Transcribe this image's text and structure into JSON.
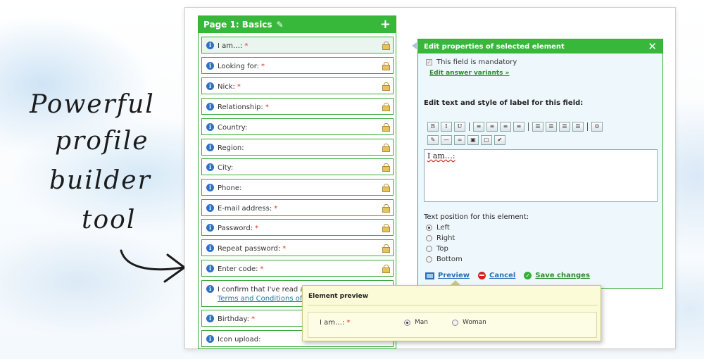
{
  "tagline": [
    "Powerful",
    "profile",
    "builder",
    "tool"
  ],
  "page": {
    "title": "Page 1: Basics",
    "fields": [
      {
        "label": "I am…:",
        "required": "*",
        "locked": true
      },
      {
        "label": "Looking for:",
        "required": "*",
        "locked": true
      },
      {
        "label": "Nick:",
        "required": "*",
        "locked": true
      },
      {
        "label": "Relationship:",
        "required": "*",
        "locked": true
      },
      {
        "label": "Country:",
        "required": "",
        "locked": true
      },
      {
        "label": "Region:",
        "required": "",
        "locked": true
      },
      {
        "label": "City:",
        "required": "",
        "locked": true
      },
      {
        "label": "Phone:",
        "required": "",
        "locked": true
      },
      {
        "label": "E-mail address:",
        "required": "*",
        "locked": true
      },
      {
        "label": "Password:",
        "required": "*",
        "locked": true
      },
      {
        "label": "Repeat password:",
        "required": "*",
        "locked": true
      },
      {
        "label": "Enter code:",
        "required": "*",
        "locked": true
      },
      {
        "label": "I confirm that I've read and a",
        "link": "Terms and Conditions of Me",
        "required": "",
        "locked": false
      },
      {
        "label": "Birthday:",
        "required": "*",
        "locked": false
      },
      {
        "label": "Icon upload:",
        "required": "",
        "locked": false
      }
    ]
  },
  "edit": {
    "title": "Edit properties of selected element",
    "mandatory_label": "This field is mandatory",
    "answer_link": "Edit answer variants »",
    "style_title": "Edit text and style of label for this field:",
    "toolbar_row1": [
      "B",
      "I",
      "U",
      "|",
      "≡",
      "≡",
      "≡",
      "≡",
      "|",
      "☰",
      "☰",
      "☰",
      "☰",
      "|",
      "☺"
    ],
    "toolbar_row2": [
      "✎",
      "—",
      "∞",
      "▣",
      "▢",
      "✔"
    ],
    "editor_text": "I am…:",
    "position_title": "Text position for this element:",
    "positions": [
      "Left",
      "Right",
      "Top",
      "Bottom"
    ],
    "selected_position": "Left",
    "preview_label": "Preview",
    "cancel_label": "Cancel",
    "save_label": "Save changes"
  },
  "preview": {
    "title": "Element preview",
    "label": "I am…:",
    "required": "*",
    "options": [
      "Man",
      "Woman"
    ],
    "selected": "Man"
  },
  "colors": {
    "accent": "#37b83a",
    "panel": "#eef7fc",
    "popup": "#fbfbd8"
  }
}
